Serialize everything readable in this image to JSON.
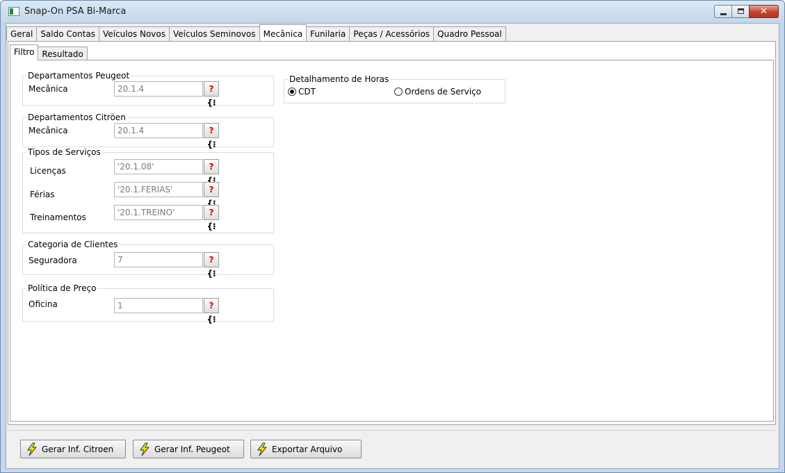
{
  "window": {
    "title": "Snap-On PSA Bi-Marca"
  },
  "top_tabs": [
    "Geral",
    "Saldo Contas",
    "Veículos Novos",
    "Veículos Seminovos",
    "Mecânica",
    "Funilaria",
    "Peças / Acessórios",
    "Quadro Pessoal"
  ],
  "top_tab_active": "Mecânica",
  "inner_tabs": [
    "Filtro",
    "Resultado"
  ],
  "inner_tab_active": "Filtro",
  "groups": {
    "peugeot": {
      "title": "Departamentos Peugeot",
      "label": "Mecânica",
      "value": "20.1.4"
    },
    "citroen": {
      "title": "Departamentos Citröen",
      "label": "Mecânica",
      "value": "20.1.4"
    },
    "servicos": {
      "title": "Tipos de Serviços",
      "rows": [
        {
          "label": "Licenças",
          "value": "'20.1.08'"
        },
        {
          "label": "Férias",
          "value": "'20.1.FERIAS'"
        },
        {
          "label": "Treinamentos",
          "value": "'20.1.TREINO'"
        }
      ]
    },
    "clientes": {
      "title": "Categoria de Clientes",
      "label": "Seguradora",
      "value": "7"
    },
    "preco": {
      "title": "Política de Preço",
      "label": "Oficina",
      "value": "1"
    },
    "horas": {
      "title": "Detalhamento de Horas",
      "opt1": "CDT",
      "opt2": "Ordens de Serviço",
      "selected": "CDT"
    }
  },
  "lookup": {
    "q": "?",
    "b": "{⁝"
  },
  "buttons": {
    "citroen": "Gerar Inf. Citroen",
    "peugeot": "Gerar Inf. Peugeot",
    "exportar": "Exportar Arquivo"
  },
  "icons": {
    "lookup": "lookup-icon",
    "bolt": "lightning-icon"
  },
  "colors": {
    "accent_red": "#d40000",
    "bolt_yellow": "#f5e400"
  }
}
